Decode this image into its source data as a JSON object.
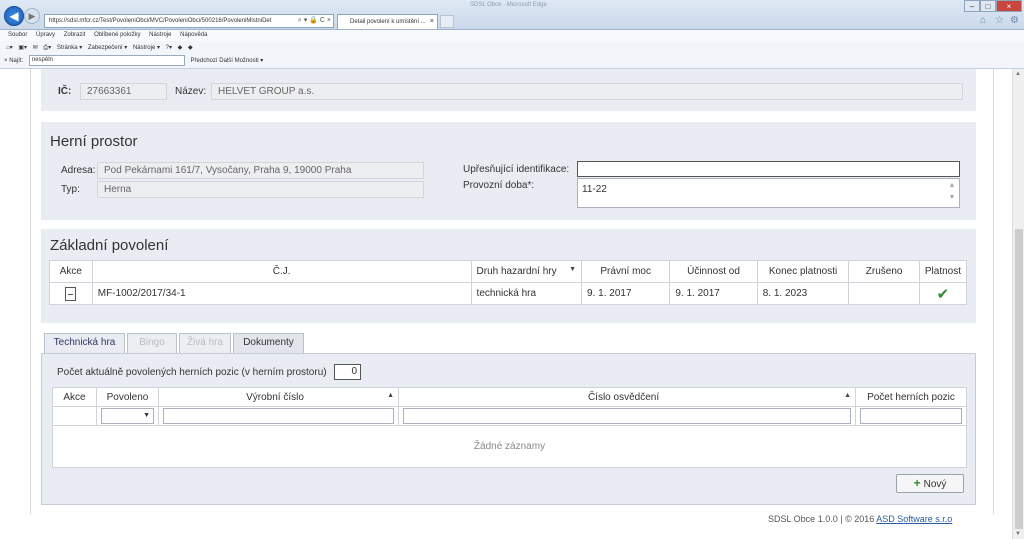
{
  "browser": {
    "url": "https://sdsl.mfcr.cz/Test/PovoleniObci/MVC/PovoleniObci/500216/PovoleniMistniDet",
    "tab_title": "Detail povolení k umístění ...",
    "window_title": "SDSL Obce - Microsoft Edge",
    "menu": [
      "Soubor",
      "Úpravy",
      "Zobrazit",
      "Oblíbené položky",
      "Nástroje",
      "Nápověda"
    ],
    "toolbar": [
      "Stránka ▾",
      "Zabezpečení ▾",
      "Nástroje ▾"
    ],
    "find": {
      "label": "Najít:",
      "value": "nespěln",
      "prev": "Předchozí",
      "next": "Další",
      "options": "Možnosti ▾"
    }
  },
  "owner": {
    "ic_label": "IČ:",
    "ic_value": "27663361",
    "name_label": "Název:",
    "name_value": "HELVET GROUP a.s."
  },
  "herni_prostor": {
    "title": "Herní prostor",
    "adresa_label": "Adresa:",
    "adresa_value": "Pod Pekárnami 161/7, Vysočany, Praha 9, 19000 Praha",
    "typ_label": "Typ:",
    "typ_value": "Herna",
    "upresnujici_label": "Upřesňující identifikace:",
    "upresnujici_value": "",
    "provozni_label": "Provozní doba*:",
    "provozni_value": "11-22"
  },
  "zakladni_povoleni": {
    "title": "Základní povolení",
    "columns": [
      "Akce",
      "Č.J.",
      "Druh hazardní hry",
      "Právní moc",
      "Účinnost od",
      "Konec platnosti",
      "Zrušeno",
      "Platnost"
    ],
    "rows": [
      {
        "cj": "MF-1002/2017/34-1",
        "druh": "technická hra",
        "pravni_moc": "9. 1. 2017",
        "ucinnost_od": "9. 1. 2017",
        "konec_platnosti": "8. 1. 2023",
        "zruseno": ""
      }
    ]
  },
  "tabs": [
    "Technická hra",
    "Bingo",
    "Živá hra",
    "Dokumenty"
  ],
  "technicka_hra": {
    "count_label": "Počet aktuálně povolených herních pozic (v herním prostoru)",
    "count_value": "0",
    "columns": [
      "Akce",
      "Povoleno",
      "Výrobní číslo",
      "Číslo osvědčení",
      "Počet herních pozic"
    ],
    "empty_text": "Žádné záznamy",
    "new_button": "Nový"
  },
  "footer": {
    "version": "SDSL Obce 1.0.0",
    "copyright": "| © 2016",
    "company": "ASD Software s.r.o"
  }
}
